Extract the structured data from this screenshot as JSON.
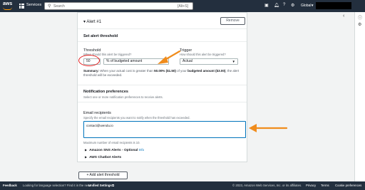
{
  "topbar": {
    "logo": "aws",
    "services_label": "Services",
    "search_placeholder": "Search",
    "search_shortcut": "[Alt+S]",
    "region": "Global"
  },
  "card": {
    "title": "Alert #1",
    "remove_label": "Remove",
    "set_threshold_title": "Set alert threshold",
    "threshold": {
      "label": "Threshold",
      "description": "When should this alert be triggered?",
      "value": "50",
      "unit": "% of budgeted amount"
    },
    "trigger": {
      "label": "Trigger",
      "description": "How should this alert be triggered?",
      "value": "Actual"
    },
    "summary": {
      "prefix": "Summary:",
      "part1": " When your actual cost is greater than ",
      "amount_percent": "50.00% ($1.50)",
      "part2": " of your ",
      "budget_label": "budgeted amount ($3.00)",
      "part3": ", the alert threshold will be exceeded."
    },
    "notification_title": "Notification preferences",
    "notification_desc": "Select one or more notification preferences to receive alerts.",
    "email": {
      "label": "Email recipients",
      "description": "Specify the email recipients you want to notify when the threshold has exceeded.",
      "value": "contact@wendu.io",
      "hint": "Maximum number of email recipients is 10."
    },
    "sns_label": "Amazon SNS Alerts",
    "sns_optional": " - Optional",
    "sns_info": "Info",
    "chatbot_label": "AWS Chatbot Alerts"
  },
  "add_alert_label": "+ Add alert threshold",
  "footer": {
    "feedback": "Feedback",
    "language_prompt": "Looking for language selection? Find it in the new",
    "unified_settings": "Unified Settings",
    "copyright": "© 2023, Amazon Web Services, Inc. or its affiliates.",
    "privacy": "Privacy",
    "terms": "Terms",
    "cookie": "Cookie preferences"
  },
  "colors": {
    "nav_bg": "#232f3e",
    "accent_orange": "#f08c1c",
    "annotation_red": "#e31c1c",
    "link_blue": "#0073bb"
  }
}
